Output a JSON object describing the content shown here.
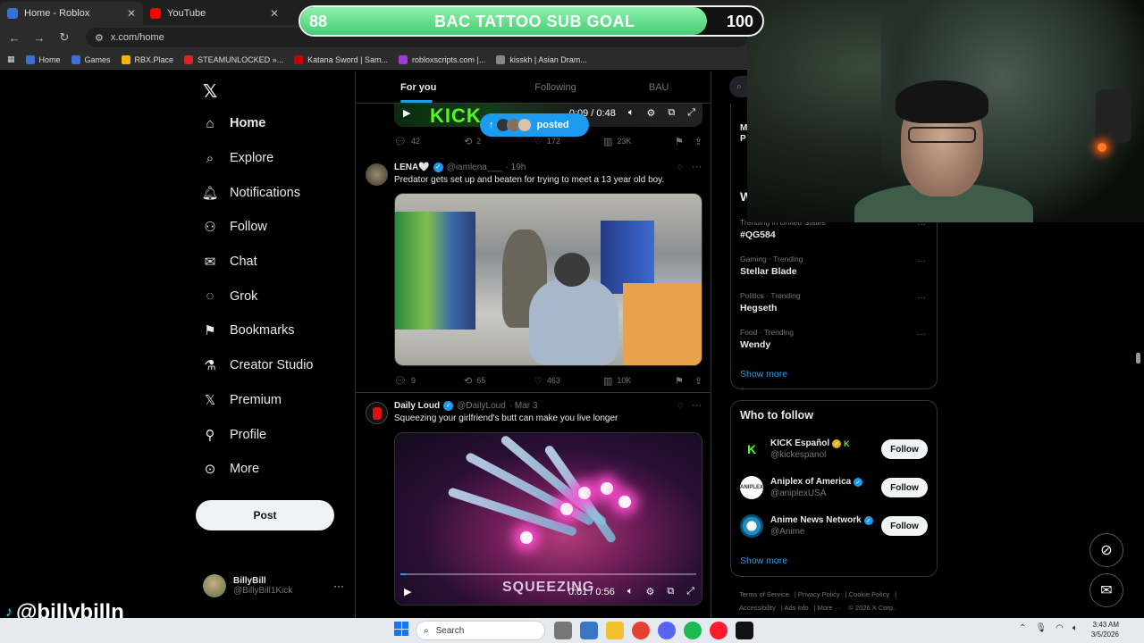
{
  "browser": {
    "tabs": [
      {
        "title": "Home - Roblox",
        "color": "#3b6fd8",
        "active": true
      },
      {
        "title": "YouTube",
        "color": "#ff0000",
        "active": false
      }
    ],
    "url": "x.com/home",
    "bookmarks": [
      "Home",
      "Games",
      "RBX.Place",
      "STEAMUNLOCKED »...",
      "Katana Sword | Sam...",
      "robloxscripts.com |...",
      "kisskh | Asian Dram..."
    ]
  },
  "overlay": {
    "goal_title": "BAC TATTOO SUB GOAL",
    "goal_current": "88",
    "goal_target": "100",
    "goal_fraction": 0.88,
    "streamer_tag": "@billybilln"
  },
  "sidebar": {
    "items": [
      {
        "label": "Home",
        "icon": "home-icon",
        "active": true
      },
      {
        "label": "Explore",
        "icon": "search-icon"
      },
      {
        "label": "Notifications",
        "icon": "bell-icon"
      },
      {
        "label": "Follow",
        "icon": "add-person-icon"
      },
      {
        "label": "Chat",
        "icon": "mail-icon"
      },
      {
        "label": "Grok",
        "icon": "grok-icon"
      },
      {
        "label": "Bookmarks",
        "icon": "bookmark-icon"
      },
      {
        "label": "Creator Studio",
        "icon": "flask-icon"
      },
      {
        "label": "Premium",
        "icon": "x-icon"
      },
      {
        "label": "Profile",
        "icon": "person-icon"
      },
      {
        "label": "More",
        "icon": "more-circle-icon"
      }
    ],
    "post_label": "Post",
    "profile": {
      "name": "BillyBill",
      "handle": "@BillyBill1Kick"
    }
  },
  "feed": {
    "tabs": [
      "For you",
      "Following",
      "BAU"
    ],
    "top_video": {
      "time": "0:09 / 0:48",
      "logo_text": "KICK"
    },
    "posted_label": "posted",
    "top_actions": {
      "replies": "42",
      "reposts": "2",
      "likes": "172",
      "views": "23K"
    },
    "tweets": [
      {
        "name": "LENA🤍",
        "handle": "@iamlena___",
        "time": "· 19h",
        "text": "Predator gets set up and beaten for trying to meet a 13 year old boy.",
        "replies": "9",
        "reposts": "65",
        "likes": "463",
        "views": "10K"
      },
      {
        "name": "Daily Loud",
        "handle": "@DailyLoud",
        "time": "· Mar 3",
        "text": "Squeezing your girlfriend's butt can make you live longer",
        "video_time": "0:01 / 0:56",
        "video_caption": "SQUEEZING",
        "progress_fraction": 0.02
      }
    ]
  },
  "right": {
    "peek_text": "M\nP",
    "peek_heading": "W",
    "trends": [
      {
        "context": "Trending in United States",
        "name": "#QG584"
      },
      {
        "context": "Gaming · Trending",
        "name": "Stellar Blade"
      },
      {
        "context": "Politics · Trending",
        "name": "Hegseth"
      },
      {
        "context": "Food · Trending",
        "name": "Wendy"
      }
    ],
    "show_more": "Show more",
    "who_to_follow_title": "Who to follow",
    "follows": [
      {
        "name": "KICK Español",
        "handle": "@kickespanol",
        "button": "Follow"
      },
      {
        "name": "Aniplex of America",
        "handle": "@aniplexUSA",
        "button": "Follow"
      },
      {
        "name": "Anime News Network",
        "handle": "@Anime",
        "button": "Follow"
      }
    ],
    "footer_links": [
      "Terms of Service",
      "Privacy Policy",
      "Cookie Policy",
      "Accessibility",
      "Ads info",
      "More ···",
      "© 2026 X Corp."
    ]
  },
  "taskbar": {
    "search_placeholder": "Search",
    "time": "3:43 AM",
    "date": "3/5/2026"
  }
}
